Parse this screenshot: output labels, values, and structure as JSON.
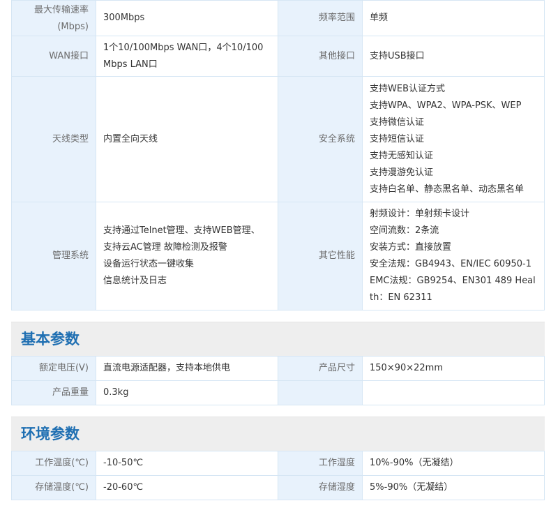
{
  "spec_table": {
    "rows": [
      {
        "l1": "最大传输速率(Mbps)",
        "v1": "300Mbps",
        "l2": "频率范围",
        "v2": "单频"
      },
      {
        "l1": "WAN接口",
        "v1": "1个10/100Mbps WAN口，4个10/100Mbps LAN口",
        "l2": "其他接口",
        "v2": "支持USB接口"
      },
      {
        "l1": "天线类型",
        "v1": "内置全向天线",
        "l2": "安全系统",
        "v2_lines": [
          "支持WEB认证方式",
          "支持WPA、WPA2、WPA-PSK、WEP",
          "支持微信认证",
          "支持短信认证",
          "支持无感知认证",
          "支持漫游免认证",
          "支持白名单、静态黑名单、动态黑名单"
        ]
      },
      {
        "l1": "管理系统",
        "v1_lines": [
          "支持通过Telnet管理、支持WEB管理、",
          "支持云AC管理 故障检测及报警",
          "设备运行状态一键收集",
          "信息统计及日志"
        ],
        "l2": "其它性能",
        "v2_lines": [
          "射频设计：单射频卡设计",
          "空间流数：2条流",
          "安装方式：直接放置",
          "安全法规：GB4943、EN/IEC 60950-1",
          "EMC法规：GB9254、EN301 489 Health：EN 62311"
        ]
      }
    ]
  },
  "basic_params": {
    "title": "基本参数",
    "rows": [
      {
        "l1": "额定电压(V)",
        "v1": "直流电源适配器，支持本地供电",
        "l2": "产品尺寸",
        "v2": "150×90×22mm"
      },
      {
        "l1": "产品重量",
        "v1": "0.3kg",
        "l2": "",
        "v2": ""
      }
    ]
  },
  "env_params": {
    "title": "环境参数",
    "rows": [
      {
        "l1": "工作温度(℃)",
        "v1": "-10-50℃",
        "l2": "工作湿度",
        "v2": "10%-90%（无凝结）"
      },
      {
        "l1": "存储温度(℃)",
        "v1": "-20-60℃",
        "l2": "存储湿度",
        "v2": "5%-90%（无凝结）"
      }
    ]
  },
  "colors": {
    "label_bg": "#e8f2fc",
    "border": "#d6e6f4",
    "section_title": "#1f6fb2",
    "section_bg": "#eeeeee"
  }
}
